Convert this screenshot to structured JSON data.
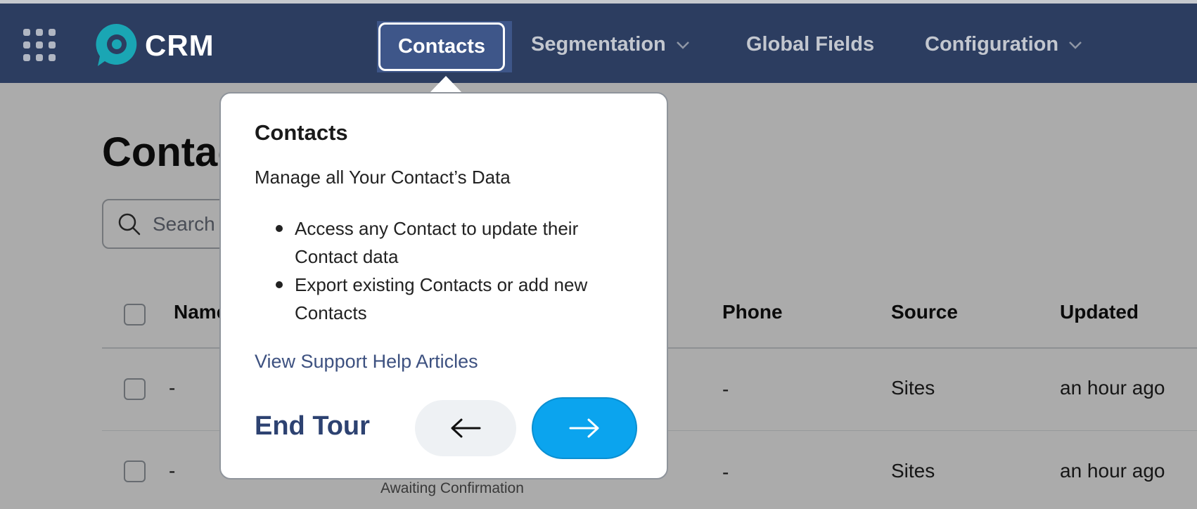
{
  "app": {
    "brand": "CRM",
    "colors": {
      "nav_bg": "#2c3d60",
      "accent": "#0ba4ee",
      "logo": "#1aa6b4"
    }
  },
  "nav": {
    "items": [
      {
        "label": "Contacts",
        "active": true
      },
      {
        "label": "Segmentation",
        "has_dropdown": true
      },
      {
        "label": "Global Fields"
      },
      {
        "label": "Configuration",
        "has_dropdown": true
      }
    ]
  },
  "page": {
    "title": "Contacts",
    "search_placeholder": "Search"
  },
  "table": {
    "headers": [
      "Name",
      "Phone",
      "Source",
      "Updated"
    ],
    "rows": [
      {
        "name": "-",
        "phone": "-",
        "source": "Sites",
        "updated": "an hour ago"
      },
      {
        "name": "-",
        "phone": "-",
        "source": "Sites",
        "updated": "an hour ago",
        "status": "Awaiting Confirmation"
      }
    ]
  },
  "tour": {
    "title": "Contacts",
    "subtitle": "Manage all Your Contact’s Data",
    "bullets": [
      "Access any Contact to update their Contact data",
      "Export existing Contacts or add new Contacts"
    ],
    "help_link": "View Support Help Articles",
    "end_label": "End Tour",
    "prev_icon": "arrow-left-icon",
    "next_icon": "arrow-right-icon"
  }
}
